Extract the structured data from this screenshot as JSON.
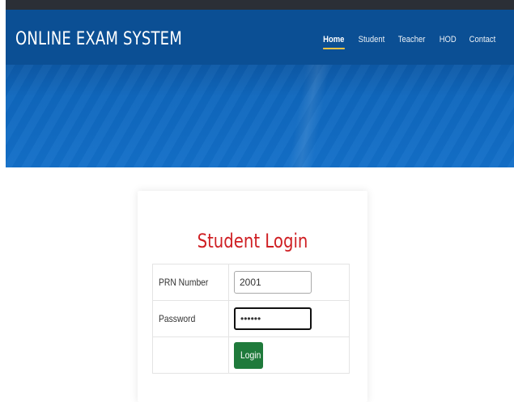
{
  "header": {
    "brand": "ONLINE EXAM SYSTEM",
    "nav": [
      {
        "label": "Home",
        "active": true
      },
      {
        "label": "Student",
        "active": false
      },
      {
        "label": "Teacher",
        "active": false
      },
      {
        "label": "HOD",
        "active": false
      },
      {
        "label": "Contact",
        "active": false
      }
    ],
    "colors": {
      "navbar": "#0b4f94",
      "hero": "#0f67bd",
      "active_underline": "#f6c343"
    }
  },
  "login": {
    "title": "Student Login",
    "prn_label": "PRN Number",
    "prn_value": "2001",
    "password_label": "Password",
    "password_value": "••••••",
    "login_button": "Login",
    "colors": {
      "title": "#cf1f23",
      "button": "#1f7a3b"
    }
  }
}
